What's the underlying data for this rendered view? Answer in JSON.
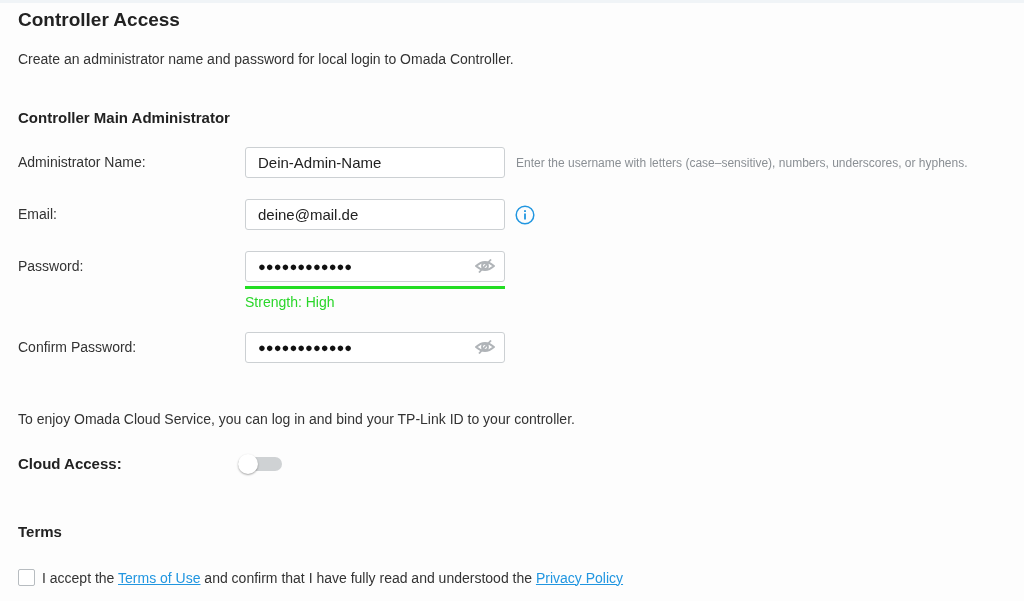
{
  "title": "Controller Access",
  "description": "Create an administrator name and password for local login to Omada Controller.",
  "admin": {
    "heading": "Controller Main Administrator",
    "fields": [
      {
        "kind": "text",
        "label": "Administrator Name:",
        "value": "Dein-Admin-Name",
        "hint": "Enter the username with letters (case–sensitive), numbers, underscores, or hyphens."
      },
      {
        "kind": "text",
        "label": "Email:",
        "value": "deine@mail.de",
        "info": true
      },
      {
        "kind": "password",
        "label": "Password:",
        "value": "●●●●●●●●●●●●",
        "strength": {
          "reading": "Strength: High"
        }
      },
      {
        "kind": "password",
        "label": "Confirm Password:",
        "value": "●●●●●●●●●●●●"
      }
    ]
  },
  "cloud": {
    "text": "To enjoy Omada Cloud Service, you can log in and bind your TP-Link ID to your controller.",
    "label": "Cloud Access:",
    "on": false
  },
  "terms": {
    "heading": "Terms",
    "checked": false,
    "parts": [
      {
        "kind": "text",
        "text": "I accept the "
      },
      {
        "kind": "link",
        "text": "Terms of Use"
      },
      {
        "kind": "text",
        "text": " and confirm that I have fully read and understood the "
      },
      {
        "kind": "link",
        "text": "Privacy Policy"
      }
    ]
  }
}
